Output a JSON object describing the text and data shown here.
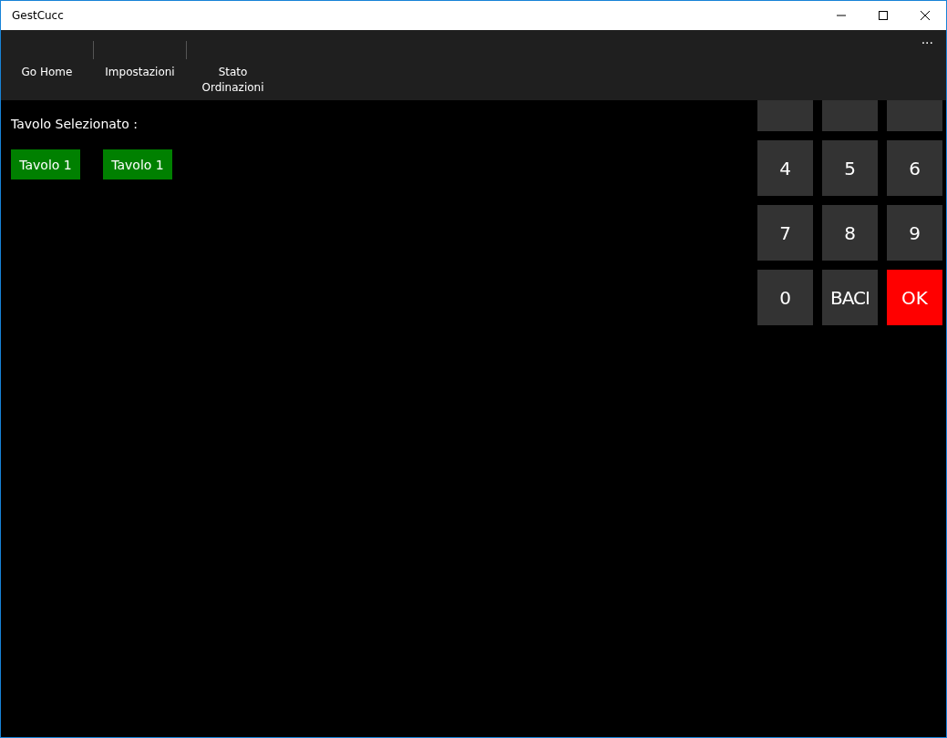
{
  "window": {
    "title": "GestCucc"
  },
  "command_bar": {
    "items": [
      {
        "label": "Go Home"
      },
      {
        "label": "Impostazioni"
      },
      {
        "label": "Stato\nOrdinazioni"
      }
    ],
    "more": "···"
  },
  "selection": {
    "label": "Tavolo Selezionato :",
    "tables": [
      "Tavolo 1",
      "Tavolo 1"
    ]
  },
  "keypad": [
    {
      "kind": "cut"
    },
    {
      "kind": "cut"
    },
    {
      "kind": "cut"
    },
    {
      "label": "4",
      "kind": "digit"
    },
    {
      "label": "5",
      "kind": "digit"
    },
    {
      "label": "6",
      "kind": "digit"
    },
    {
      "label": "7",
      "kind": "digit"
    },
    {
      "label": "8",
      "kind": "digit"
    },
    {
      "label": "9",
      "kind": "digit"
    },
    {
      "label": "0",
      "kind": "digit"
    },
    {
      "label": "BACI",
      "kind": "digit"
    },
    {
      "label": "OK",
      "kind": "ok"
    }
  ]
}
